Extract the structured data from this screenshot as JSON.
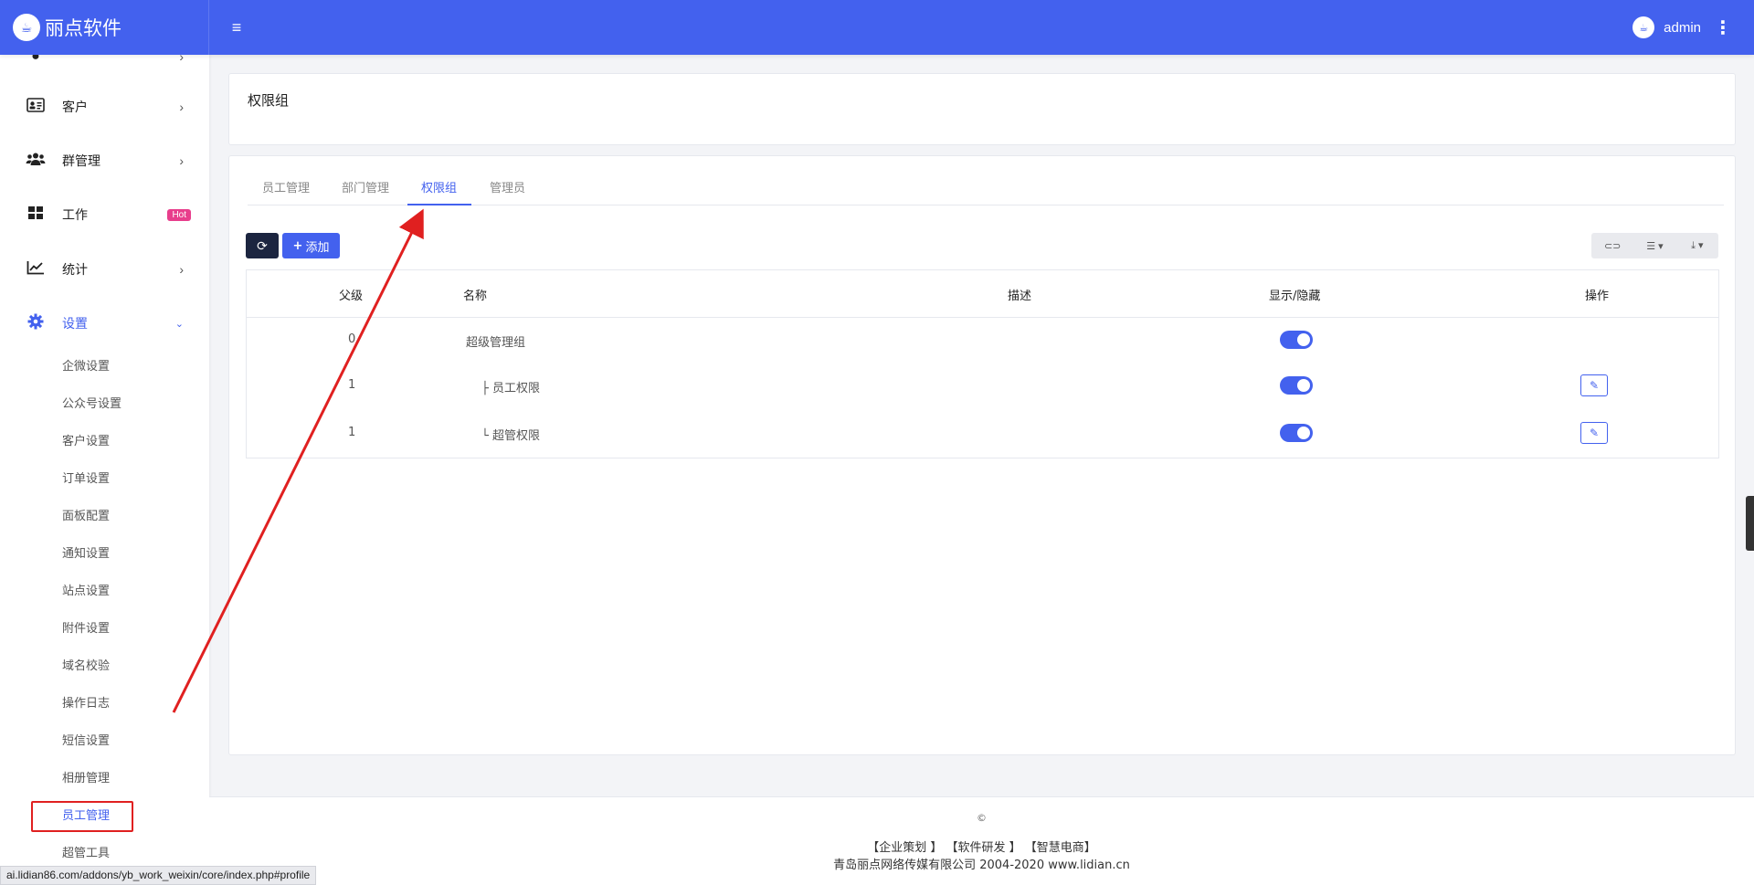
{
  "brand": {
    "name": "丽点软件",
    "logo_icon": "logo-icon"
  },
  "user": {
    "name": "admin"
  },
  "sidebar": {
    "items": [
      {
        "label": "客户",
        "icon": "id-card-icon"
      },
      {
        "label": "群管理",
        "icon": "users-icon"
      },
      {
        "label": "工作",
        "icon": "grid-icon",
        "badge": "Hot"
      },
      {
        "label": "统计",
        "icon": "chart-line-icon"
      },
      {
        "label": "设置",
        "icon": "gear-icon"
      }
    ],
    "sub_items": [
      "企微设置",
      "公众号设置",
      "客户设置",
      "订单设置",
      "面板配置",
      "通知设置",
      "站点设置",
      "附件设置",
      "域名校验",
      "操作日志",
      "短信设置",
      "相册管理",
      "员工管理",
      "超管工具"
    ]
  },
  "page": {
    "title": "权限组"
  },
  "tabs": [
    "员工管理",
    "部门管理",
    "权限组",
    "管理员"
  ],
  "toolbar": {
    "add_label": "添加"
  },
  "table": {
    "headers": [
      "父级",
      "名称",
      "描述",
      "显示/隐藏",
      "操作"
    ],
    "rows": [
      {
        "parent": "0",
        "name": "超级管理组"
      },
      {
        "parent": "1",
        "name": "├ 员工权限"
      },
      {
        "parent": "1",
        "name": "└ 超管权限"
      }
    ]
  },
  "footer": {
    "copyright": "©",
    "links": "【企业策划 】 【软件研发 】 【智慧电商】",
    "company": "青岛丽点网络传媒有限公司 2004-2020 www.lidian.cn"
  },
  "status_bar": {
    "url": "ai.lidian86.com/addons/yb_work_weixin/core/index.php#profile"
  },
  "colors": {
    "primary": "#4361ee",
    "dark": "#1c2540",
    "hot": "#e83e8c",
    "annotation": "#e02020"
  }
}
